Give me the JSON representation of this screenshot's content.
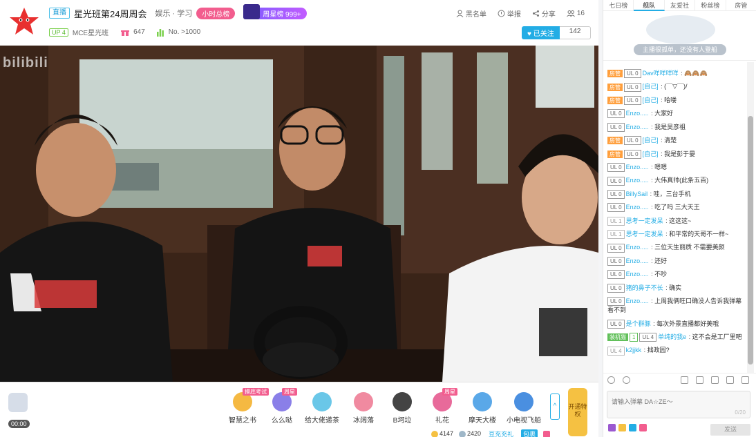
{
  "header": {
    "live_label": "直播",
    "title": "星光班第24周周会",
    "category": "娱乐 · 学习",
    "hour_rank": "小时总榜",
    "week_star": "周星榜 999+",
    "up_level": "UP 4",
    "anchor_name": "MCE星光班",
    "gift_count": "647",
    "rank": "No. >1000",
    "tools": [
      "黑名单",
      "举报",
      "分享",
      "16"
    ],
    "follow_label": "已关注",
    "follow_count": "142"
  },
  "video": {
    "watermark": "bilibili"
  },
  "gift_bar": {
    "timer": "00:00",
    "gifts": [
      {
        "name": "智慧之书",
        "tag": "摸底考试",
        "color": "#f5b942"
      },
      {
        "name": "么么哒",
        "tag": "周星",
        "color": "#8a7fe8"
      },
      {
        "name": "给大佬递茶",
        "tag": "",
        "color": "#6ac7e8"
      },
      {
        "name": "冰阔落",
        "tag": "",
        "color": "#f08aa0"
      },
      {
        "name": "B坷垃",
        "tag": "",
        "color": "#444444"
      },
      {
        "name": "礼花",
        "tag": "周星",
        "color": "#e86a9a"
      },
      {
        "name": "摩天大楼",
        "tag": "",
        "color": "#5aa8e8"
      },
      {
        "name": "小电视飞船",
        "tag": "",
        "color": "#4a8fe0"
      }
    ],
    "vip_label": "开通特权",
    "gold": "4147",
    "silver": "2420",
    "recharge": "豆充充礼",
    "package": "包裹"
  },
  "sidebar": {
    "tabs": [
      "七日榜",
      "舰队",
      "友爱社",
      "粉丝榜",
      "房管"
    ],
    "active_tab": 1,
    "empty_text": "主播很孤单，还没有人登船",
    "chat": [
      {
        "badges": [
          [
            "房管",
            "fg"
          ],
          [
            "UL 0",
            "ul"
          ]
        ],
        "user": "Dav咩咩咩咩",
        "text": "🙈🙈🙈"
      },
      {
        "badges": [
          [
            "房管",
            "fg"
          ],
          [
            "UL 0",
            "ul"
          ]
        ],
        "user": "[自己]",
        "text": "(￣▽￣)/"
      },
      {
        "badges": [
          [
            "房管",
            "fg"
          ],
          [
            "UL 0",
            "ul"
          ]
        ],
        "user": "[自己]",
        "text": "哈喽"
      },
      {
        "badges": [
          [
            "UL 0",
            "ul"
          ]
        ],
        "user": "Enzo.....",
        "text": "大家好"
      },
      {
        "badges": [
          [
            "UL 0",
            "ul"
          ]
        ],
        "user": "Enzo.....",
        "text": "我是吴彦祖"
      },
      {
        "badges": [
          [
            "房管",
            "fg"
          ],
          [
            "UL 0",
            "ul"
          ]
        ],
        "user": "[自己]",
        "text": "清楚"
      },
      {
        "badges": [
          [
            "房管",
            "fg"
          ],
          [
            "UL 0",
            "ul"
          ]
        ],
        "user": "[自己]",
        "text": "我是彭于晏"
      },
      {
        "badges": [
          [
            "UL 0",
            "ul"
          ]
        ],
        "user": "Enzo.....",
        "text": "嗯嗯"
      },
      {
        "badges": [
          [
            "UL 0",
            "ul"
          ]
        ],
        "user": "Enzo.....",
        "text": "大伟真帅(此条五百)"
      },
      {
        "badges": [
          [
            "UL 0",
            "ul"
          ]
        ],
        "user": "BillySail",
        "text": "哇，三台手机"
      },
      {
        "badges": [
          [
            "UL 0",
            "ul"
          ]
        ],
        "user": "Enzo.....",
        "text": "吃了吗 三大天王"
      },
      {
        "badges": [
          [
            "UL 1",
            "ul1"
          ]
        ],
        "user": "思考一定发呆",
        "text": "这这这~"
      },
      {
        "badges": [
          [
            "UL 1",
            "ul1"
          ]
        ],
        "user": "思考一定发呆",
        "text": "和平常的天哥不一样~"
      },
      {
        "badges": [
          [
            "UL 0",
            "ul"
          ]
        ],
        "user": "Enzo.....",
        "text": "三位天生丽质 不需要美颜"
      },
      {
        "badges": [
          [
            "UL 0",
            "ul"
          ]
        ],
        "user": "Enzo.....",
        "text": "还好"
      },
      {
        "badges": [
          [
            "UL 0",
            "ul"
          ]
        ],
        "user": "Enzo.....",
        "text": "不吵"
      },
      {
        "badges": [
          [
            "UL 0",
            "ul"
          ]
        ],
        "user": "猪的鼻子不长",
        "text": "确实"
      },
      {
        "badges": [
          [
            "UL 0",
            "ul"
          ]
        ],
        "user": "Enzo.....",
        "text": "上周我俩旺口确没人告诉我弹幕看不到"
      },
      {
        "badges": [
          [
            "UL 0",
            "ul"
          ]
        ],
        "user": "是个群豚",
        "text": "每次外景直播都好美哦"
      },
      {
        "badges": [
          [
            "装机猫",
            "fan"
          ],
          [
            "1",
            "fanlv"
          ],
          [
            "UL 4",
            "ul"
          ]
        ],
        "user": "单纯的我e",
        "text": "这不会是工厂里吧"
      },
      {
        "badges": [
          [
            "UL 4",
            "ul1"
          ]
        ],
        "user": "k2jjkk",
        "text": "拙政园?"
      }
    ],
    "input_placeholder": "请输入弹幕 DA☆ZE～",
    "input_count": "0/20",
    "emoji_colors": [
      "#9b59d0",
      "#f5c142",
      "#23ade5",
      "#f25d8e"
    ],
    "send_label": "发送"
  }
}
